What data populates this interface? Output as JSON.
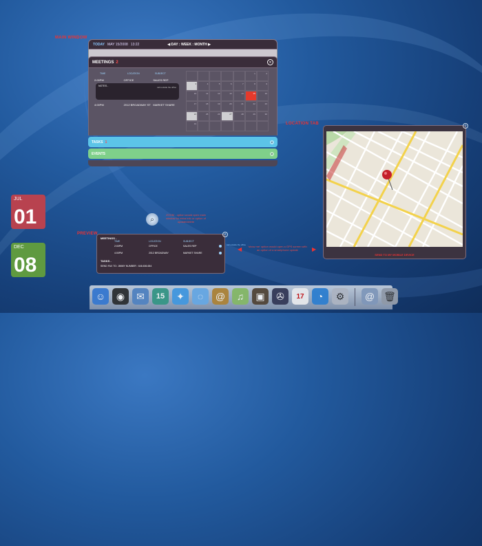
{
  "annotations": {
    "main_window": "MAIN WINDOW",
    "location_tab": "LOCATION TAB",
    "preview": "PREVIEW",
    "zoom_note": "ZOOM - option would open main window for extra info or option of update/delete",
    "show_me_note": "'show me' option would open a GPS screen with an option of a smartphone update",
    "on_callback": "call outside the office"
  },
  "main": {
    "today_label": "TODAY",
    "date": "MAY 15/2008",
    "time": "13:22",
    "nav": "◀ DAY : WEEK : MONTH ▶",
    "meetings_label": "MEETINGS",
    "meetings_count": "2",
    "columns": [
      "TIME",
      "LOCATION",
      "SUBJECT"
    ],
    "rows": [
      {
        "time": "2:00PM",
        "location": "OFFICE",
        "subject": "SALES REP"
      },
      {
        "time": "4:00PM",
        "location": "2012 BROADWAY  ST",
        "subject": "MARKET SHARE"
      }
    ],
    "notes_label": "NOTES -",
    "notes_call": "call outside the office",
    "tasks_label": "TASKS",
    "tasks_count": "1",
    "events_label": "EVENTS"
  },
  "calendar": {
    "cells": [
      "",
      "",
      "",
      "",
      "",
      "1",
      "2",
      "3",
      "4",
      "5",
      "6",
      "7",
      "8",
      "9",
      "10",
      "11",
      "12",
      "13",
      "14",
      "15",
      "16",
      "17",
      "18",
      "19",
      "20",
      "21",
      "22",
      "23",
      "24",
      "25",
      "26",
      "27",
      "28",
      "29",
      "30",
      "31",
      "",
      "",
      "",
      "",
      "",
      ""
    ],
    "highlight_indices": [
      7,
      28,
      31
    ],
    "today_index": 19
  },
  "location": {
    "send_label": "SEND TO MY MOBILE DEVICE"
  },
  "preview": {
    "meetings_label": "MEETINGS -",
    "columns": [
      "TIME",
      "LOCATION",
      "SUBJECT"
    ],
    "rows": [
      {
        "time": "2:00PM",
        "location": "OFFICE",
        "subject": "SALES REP"
      },
      {
        "time": "4:00PM",
        "location": "2012 BROADWAY",
        "subject": "MARKET SHARE"
      }
    ],
    "tasks_label": "TASKS -",
    "task": "SEND FAX TO: JIMMY NUMBER : 646.606.654"
  },
  "tiles": [
    {
      "month": "JUL",
      "day": "01",
      "color": "#b8424f"
    },
    {
      "month": "DEC",
      "day": "08",
      "color": "#5f9a40"
    }
  ],
  "dock": {
    "calendar_day": "15",
    "ical_day": "17",
    "icons": [
      "finder-icon",
      "dashboard-icon",
      "mail-icon",
      "calendar-widget-icon",
      "safari-icon",
      "ichat-icon",
      "address-book-icon",
      "itunes-icon",
      "iphoto-icon",
      "imovie-icon",
      "ical-icon",
      "time-machine-icon",
      "preferences-icon",
      "at-icon",
      "trash-icon"
    ]
  }
}
